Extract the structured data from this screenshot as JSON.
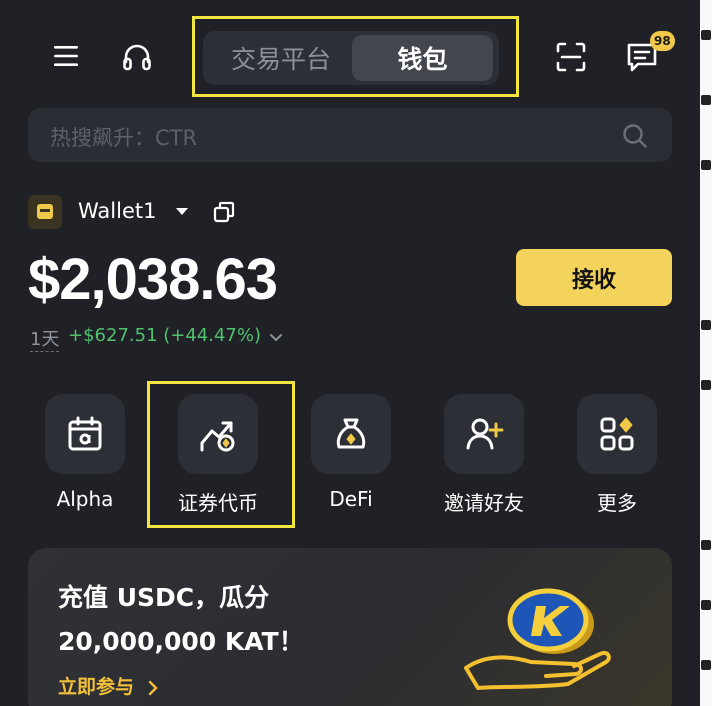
{
  "header": {
    "menu_icon": "menu-icon",
    "support_icon": "headset-icon",
    "tabs": [
      {
        "label": "交易平台",
        "active": false
      },
      {
        "label": "钱包",
        "active": true
      }
    ],
    "scan_icon": "scan-icon",
    "messages_icon": "message-icon",
    "messages_badge": "98"
  },
  "search": {
    "placeholder": "热搜飙升：CTR",
    "icon": "search-icon"
  },
  "wallet": {
    "name": "Wallet1",
    "balance": "$2,038.63",
    "period": "1天",
    "change": "+$627.51 (+44.47%)",
    "receive_label": "接收"
  },
  "quick_actions": [
    {
      "label": "Alpha",
      "icon": "calendar-alpha-icon"
    },
    {
      "label": "证券代币",
      "icon": "stock-token-icon"
    },
    {
      "label": "DeFi",
      "icon": "money-bag-icon"
    },
    {
      "label": "邀请好友",
      "icon": "add-user-icon"
    },
    {
      "label": "更多",
      "icon": "grid-more-icon"
    }
  ],
  "promo": {
    "line1": "充值 USDC，瓜分",
    "line2": "20,000,000 KAT！",
    "cta": "立即参与"
  },
  "colors": {
    "background": "#1f2126",
    "accent": "#f3d35b",
    "positive": "#4fc26f",
    "highlight_box": "#f3e53f"
  }
}
